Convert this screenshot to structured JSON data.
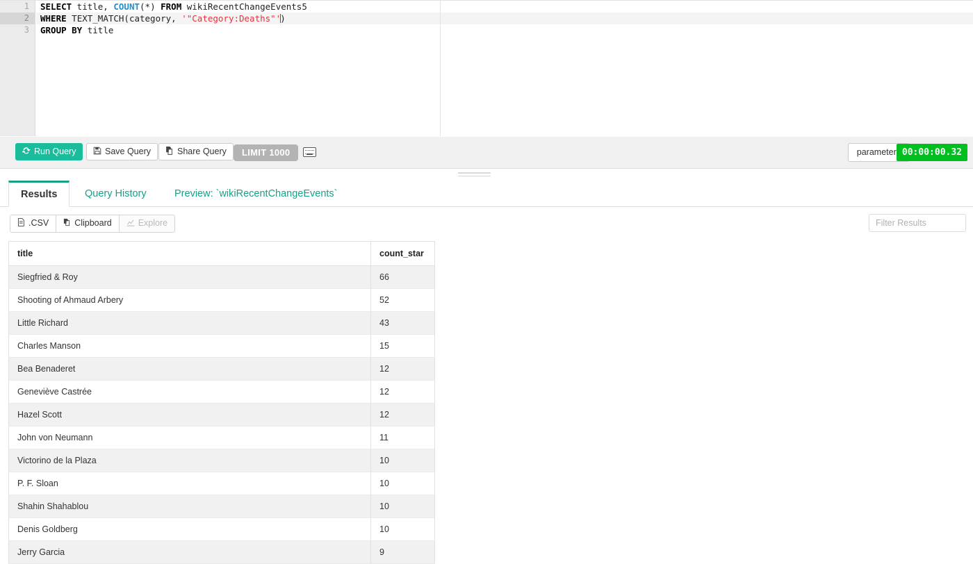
{
  "editor": {
    "lines": [
      {
        "number": "1",
        "active": false,
        "tokens": [
          {
            "t": "SELECT",
            "c": "kw"
          },
          {
            "t": " title, ",
            "c": "plain"
          },
          {
            "t": "COUNT",
            "c": "fn"
          },
          {
            "t": "(*) ",
            "c": "plain"
          },
          {
            "t": "FROM",
            "c": "kw"
          },
          {
            "t": " wikiRecentChangeEvents5",
            "c": "plain"
          }
        ],
        "text": "SELECT title, COUNT(*) FROM wikiRecentChangeEvents5"
      },
      {
        "number": "2",
        "active": true,
        "tokens": [
          {
            "t": "WHERE",
            "c": "kw"
          },
          {
            "t": " TEXT_MATCH(category, ",
            "c": "plain"
          },
          {
            "t": "'\"Category:Deaths\"'",
            "c": "str"
          },
          {
            "t": ")",
            "c": "plain"
          }
        ],
        "text": "WHERE TEXT_MATCH(category, '\"Category:Deaths\"')"
      },
      {
        "number": "3",
        "active": false,
        "tokens": [
          {
            "t": "GROUP BY",
            "c": "kw"
          },
          {
            "t": " title",
            "c": "plain"
          }
        ],
        "text": "GROUP BY title"
      }
    ]
  },
  "toolbar": {
    "run_query_label": "Run Query",
    "save_query_label": "Save Query",
    "share_query_label": "Share Query",
    "limit_label": "LIMIT 1000",
    "parameters_label": "parameters",
    "timer_value": "00:00:00.32",
    "run_icon": "refresh-icon",
    "save_icon": "floppy-disk-icon",
    "share_icon": "copy-icon",
    "keyboard_icon": "keyboard-icon",
    "accent_color": "#1abc9c",
    "timer_color": "#00c01f"
  },
  "tabs": [
    {
      "label": "Results",
      "active": true
    },
    {
      "label": "Query History",
      "active": false
    },
    {
      "label": "Preview: `wikiRecentChangeEvents`",
      "active": false
    }
  ],
  "export": {
    "csv_label": ".CSV",
    "clipboard_label": "Clipboard",
    "explore_label": "Explore",
    "csv_icon": "file-icon",
    "clipboard_icon": "clipboard-icon",
    "explore_icon": "chart-line-icon",
    "explore_disabled": true
  },
  "filter": {
    "placeholder": "Filter Results",
    "value": ""
  },
  "results_table": {
    "columns": [
      "title",
      "count_star"
    ],
    "rows": [
      [
        "Siegfried & Roy",
        "66"
      ],
      [
        "Shooting of Ahmaud Arbery",
        "52"
      ],
      [
        "Little Richard",
        "43"
      ],
      [
        "Charles Manson",
        "15"
      ],
      [
        "Bea Benaderet",
        "12"
      ],
      [
        "Geneviève Castrée",
        "12"
      ],
      [
        "Hazel Scott",
        "12"
      ],
      [
        "John von Neumann",
        "11"
      ],
      [
        "Victorino de la Plaza",
        "10"
      ],
      [
        "P. F. Sloan",
        "10"
      ],
      [
        "Shahin Shahablou",
        "10"
      ],
      [
        "Denis Goldberg",
        "10"
      ],
      [
        "Jerry Garcia",
        "9"
      ]
    ]
  }
}
